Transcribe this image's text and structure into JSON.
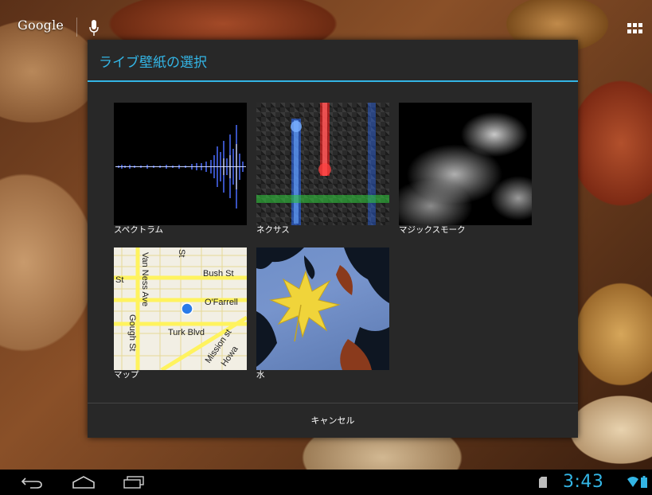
{
  "top_bar": {
    "google_search_label": "Google",
    "mic_icon": "mic-icon",
    "apps_icon": "apps-grid-icon"
  },
  "dialog": {
    "title": "ライブ壁紙の選択",
    "accent_color": "#33b5e5",
    "wallpapers": [
      {
        "label": "スペクトラム"
      },
      {
        "label": "ネクサス"
      },
      {
        "label": "マジックスモーク"
      },
      {
        "label": "マップ"
      },
      {
        "label": "水"
      }
    ],
    "cancel_label": "キャンセル"
  },
  "map_thumb": {
    "streets": [
      "St",
      "Van Ness Ave",
      "St",
      "Bush St",
      "O'Farrell",
      "Gough St",
      "Turk Blvd",
      "Mission st",
      "Howa"
    ]
  },
  "status_bar": {
    "time": "3:43",
    "clock_color": "#33b5e5",
    "icons": [
      "sd-card-icon",
      "wifi-icon",
      "battery-icon"
    ]
  },
  "nav_bar": {
    "icons": [
      "back-icon",
      "home-icon",
      "recent-apps-icon"
    ]
  }
}
